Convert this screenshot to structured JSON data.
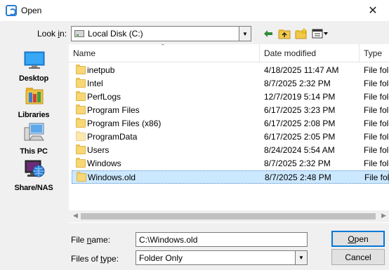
{
  "window": {
    "title": "Open",
    "close_glyph": "✕"
  },
  "lookin": {
    "label_pre": "Look ",
    "label_u": "i",
    "label_post": "n:",
    "value": "Local Disk (C:)"
  },
  "places": [
    {
      "label": "Desktop",
      "icon": "desktop-icon"
    },
    {
      "label": "Libraries",
      "icon": "libraries-icon"
    },
    {
      "label": "This PC",
      "icon": "this-pc-icon"
    },
    {
      "label": "Share/NAS",
      "icon": "share-nas-icon"
    }
  ],
  "columns": {
    "name": "Name",
    "date": "Date modified",
    "type": "Type"
  },
  "files": [
    {
      "name": "inetpub",
      "date": "4/18/2025 11:47 AM",
      "type": "File folder"
    },
    {
      "name": "Intel",
      "date": "8/7/2025 2:32 PM",
      "type": "File folder"
    },
    {
      "name": "PerfLogs",
      "date": "12/7/2019 5:14 PM",
      "type": "File folder"
    },
    {
      "name": "Program Files",
      "date": "6/17/2025 3:23 PM",
      "type": "File folder"
    },
    {
      "name": "Program Files (x86)",
      "date": "6/17/2025 2:08 PM",
      "type": "File folder"
    },
    {
      "name": "ProgramData",
      "date": "6/17/2025 2:05 PM",
      "type": "File folder"
    },
    {
      "name": "Users",
      "date": "8/24/2024 5:54 AM",
      "type": "File folder"
    },
    {
      "name": "Windows",
      "date": "8/7/2025 2:32 PM",
      "type": "File folder"
    },
    {
      "name": "Windows.old",
      "date": "8/7/2025 2:48 PM",
      "type": "File folder"
    }
  ],
  "filename": {
    "label_pre": "File ",
    "label_u": "n",
    "label_post": "ame:",
    "value": "C:\\Windows.old"
  },
  "filetype": {
    "label_pre": "Files of ",
    "label_u": "t",
    "label_post": "ype:",
    "value": "Folder Only"
  },
  "buttons": {
    "open_u": "O",
    "open_rest": "pen",
    "cancel": "Cancel"
  },
  "colors": {
    "accent": "#0078d7",
    "selection": "#cce8ff",
    "folder": "#f8d775"
  }
}
